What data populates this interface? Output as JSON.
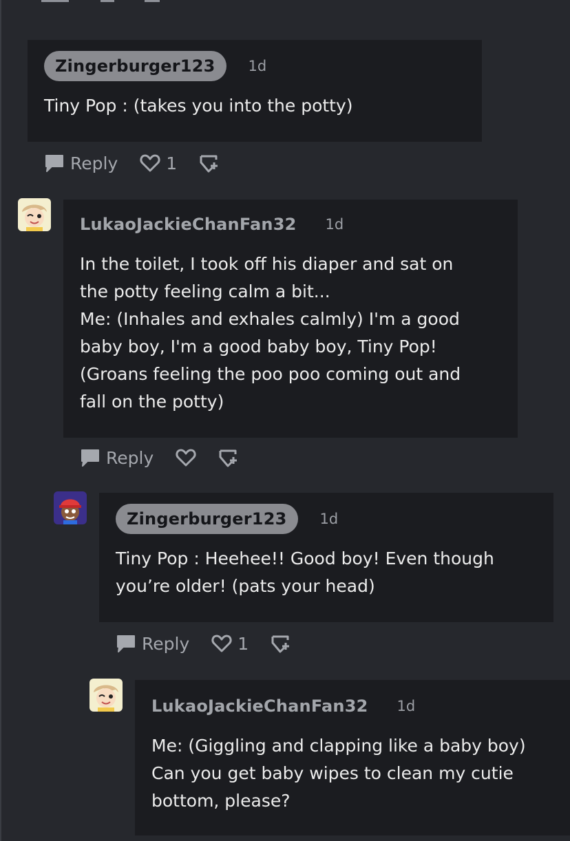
{
  "comments": [
    {
      "username": "Zingerburger123",
      "time": "1d",
      "text": "Tiny Pop : (takes you into the potty)",
      "reply_label": "Reply",
      "likes": "1",
      "avatar": "none"
    },
    {
      "username": "LukaoJackieChanFan32",
      "time": "1d",
      "text": "In the toilet, I took off his diaper and sat on\nthe potty feeling calm a bit...\nMe: (Inhales and exhales calmly) I'm a good\nbaby boy, I'm a good baby boy, Tiny Pop!\n(Groans feeling the poo poo coming out and\nfall on the potty)",
      "reply_label": "Reply",
      "likes": "",
      "avatar": "winking-cartoon-boy"
    },
    {
      "username": "Zingerburger123",
      "time": "1d",
      "text": "Tiny Pop : Heehee!! Good boy! Even though\nyou’re older! (pats your head)",
      "reply_label": "Reply",
      "likes": "1",
      "avatar": "red-cap-cartoon"
    },
    {
      "username": "LukaoJackieChanFan32",
      "time": "1d",
      "text": "Me: (Giggling and clapping like a baby boy)\nCan you get baby wipes to clean my cutie\nbottom, please?",
      "avatar": "winking-cartoon-boy"
    }
  ],
  "icons": {
    "reply": "speech-bubble-icon",
    "like": "heart-icon",
    "award": "award-plus-icon"
  },
  "colors": {
    "page_bg": "#26282d",
    "bubble_bg": "#1b1c20",
    "pill_bg": "#8a8b90",
    "muted_text": "#a5a8ae"
  }
}
